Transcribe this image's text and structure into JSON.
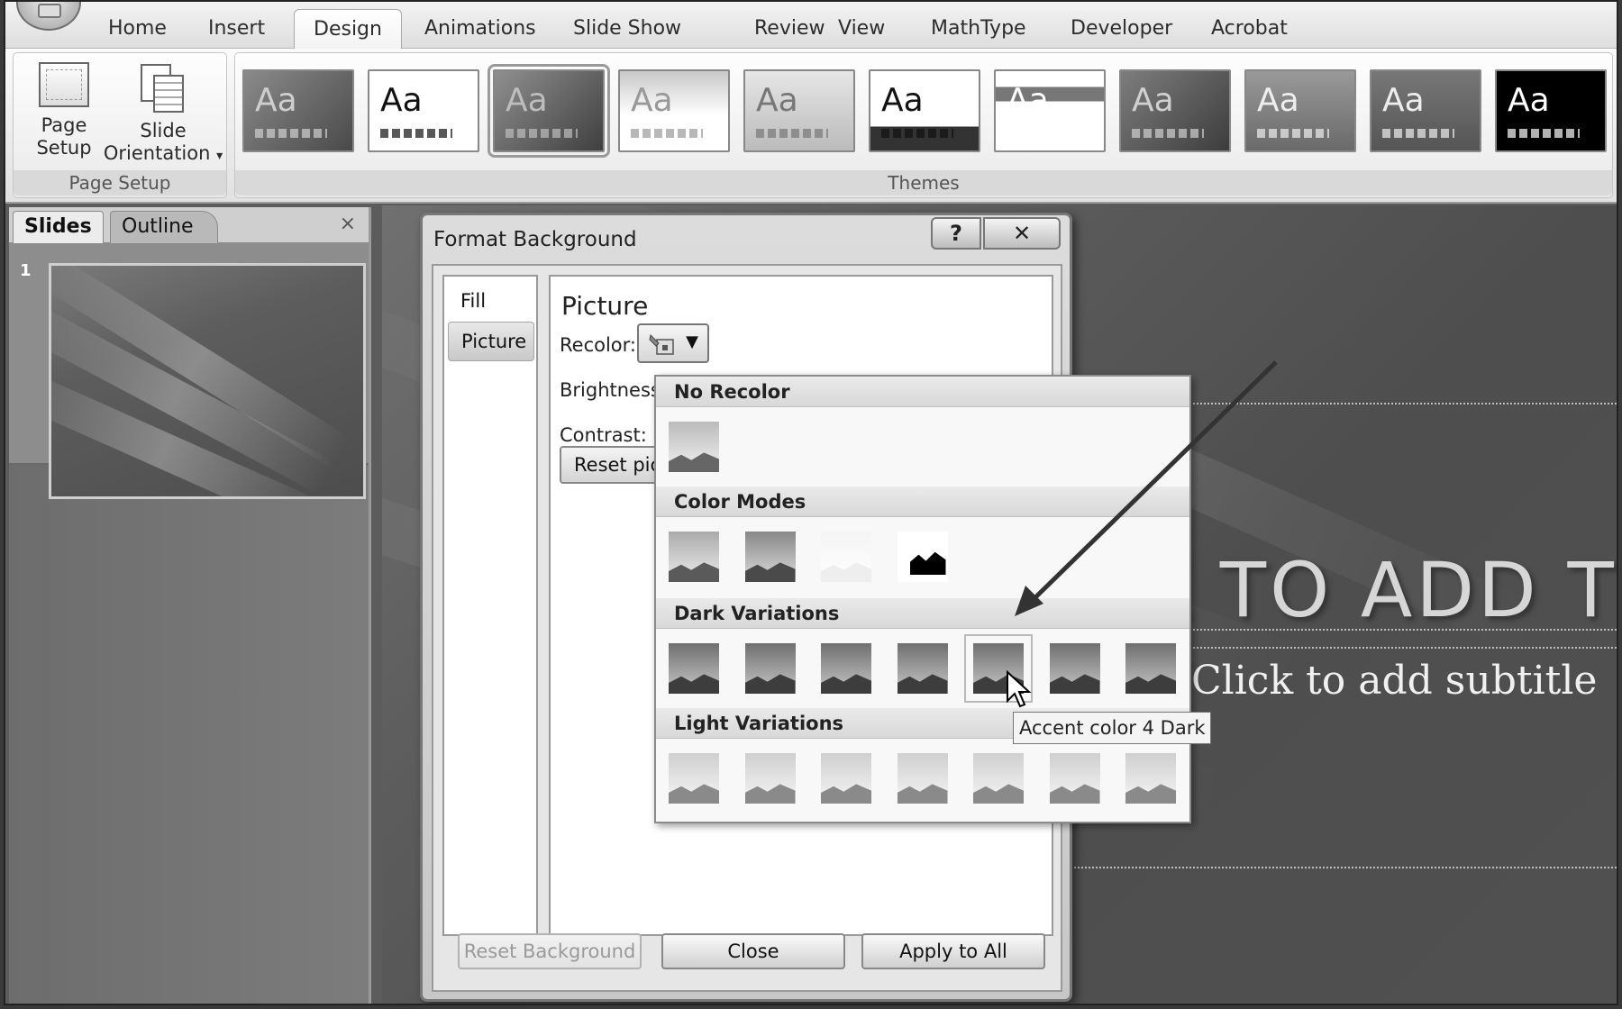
{
  "ribbon": {
    "tabs": [
      "Home",
      "Insert",
      "Design",
      "Animations",
      "Slide Show",
      "Review",
      "View",
      "MathType",
      "Developer",
      "Acrobat"
    ],
    "active_tab": "Design",
    "page_setup_group": {
      "page_setup_label": "Page Setup",
      "slide_orientation_label": "Slide Orientation",
      "group_label": "Page Setup"
    },
    "themes_group": {
      "label": "Themes",
      "thumbnail_text": "Aa",
      "count": 11
    }
  },
  "slides_pane": {
    "tab_slides": "Slides",
    "tab_outline": "Outline",
    "close_glyph": "×",
    "slide_number": "1"
  },
  "slide": {
    "title_placeholder_visible": "K TO ADD T",
    "subtitle_placeholder": "Click to add subtitle"
  },
  "dialog": {
    "title": "Format Background",
    "help_glyph": "?",
    "close_glyph": "✕",
    "nav": {
      "fill": "Fill",
      "picture": "Picture"
    },
    "panel_heading": "Picture",
    "recolor_label": "Recolor:",
    "brightness_label": "Brightness",
    "contrast_label": "Contrast:",
    "reset_picture_label": "Reset pic",
    "reset_background_label": "Reset Background",
    "close_label": "Close",
    "apply_to_all_label": "Apply to All"
  },
  "recolor_menu": {
    "sections": {
      "no_recolor": "No Recolor",
      "color_modes": "Color Modes",
      "dark_variations": "Dark Variations",
      "light_variations": "Light Variations"
    },
    "hovered_item": "Accent color 4 Dark",
    "tooltip": "Accent color 4 Dark"
  },
  "colors": {
    "ribbon_bg": "#f0f0f0",
    "slide_bg": "#5a5a5a",
    "dialog_bg": "#d4d4d4",
    "arrow": "#333333"
  }
}
